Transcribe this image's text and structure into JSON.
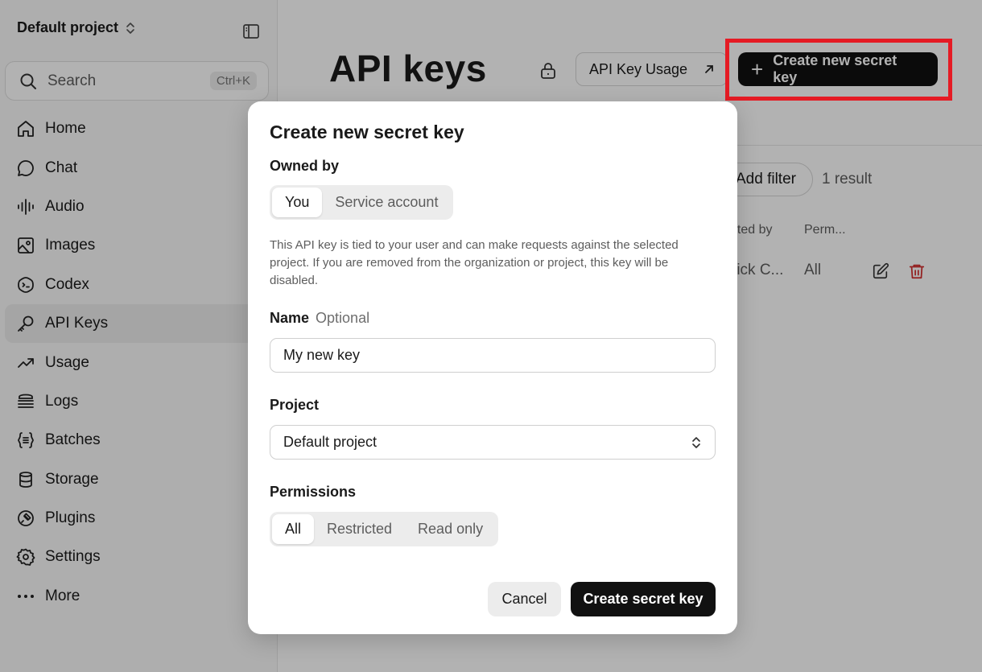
{
  "sidebar": {
    "project_name": "Default project",
    "search": {
      "placeholder": "Search",
      "shortcut": "Ctrl+K"
    },
    "items": [
      {
        "label": "Home",
        "icon": "home-icon"
      },
      {
        "label": "Chat",
        "icon": "chat-icon"
      },
      {
        "label": "Audio",
        "icon": "audio-icon"
      },
      {
        "label": "Images",
        "icon": "image-icon"
      },
      {
        "label": "Codex",
        "icon": "codex-icon"
      },
      {
        "label": "API Keys",
        "icon": "key-icon",
        "active": true
      },
      {
        "label": "Usage",
        "icon": "trend-icon"
      },
      {
        "label": "Logs",
        "icon": "logs-icon"
      },
      {
        "label": "Batches",
        "icon": "batches-icon"
      },
      {
        "label": "Storage",
        "icon": "database-icon"
      },
      {
        "label": "Plugins",
        "icon": "plugin-icon"
      },
      {
        "label": "Settings",
        "icon": "gear-icon"
      },
      {
        "label": "More",
        "icon": "more-icon"
      }
    ]
  },
  "main": {
    "title": "API keys",
    "usage_button": "API Key Usage",
    "create_button": "Create new secret key",
    "add_filter": "Add filter",
    "result_count": "1 result",
    "table": {
      "headers": [
        "ated by",
        "Perm..."
      ],
      "row": {
        "created_by": "rick C...",
        "permissions": "All"
      }
    }
  },
  "modal": {
    "title": "Create new secret key",
    "owned_by_label": "Owned by",
    "owned_by_options": [
      "You",
      "Service account"
    ],
    "owned_by_selected": "You",
    "description": "This API key is tied to your user and can make requests against the selected project. If you are removed from the organization or project, this key will be disabled.",
    "name_label": "Name",
    "name_optional": "Optional",
    "name_value": "My new key",
    "project_label": "Project",
    "project_value": "Default project",
    "permissions_label": "Permissions",
    "permissions_options": [
      "All",
      "Restricted",
      "Read only"
    ],
    "permissions_selected": "All",
    "cancel_label": "Cancel",
    "submit_label": "Create secret key"
  },
  "colors": {
    "highlight": "#e51b24",
    "primary_button": "#111111",
    "delete_icon": "#d32f2f"
  }
}
